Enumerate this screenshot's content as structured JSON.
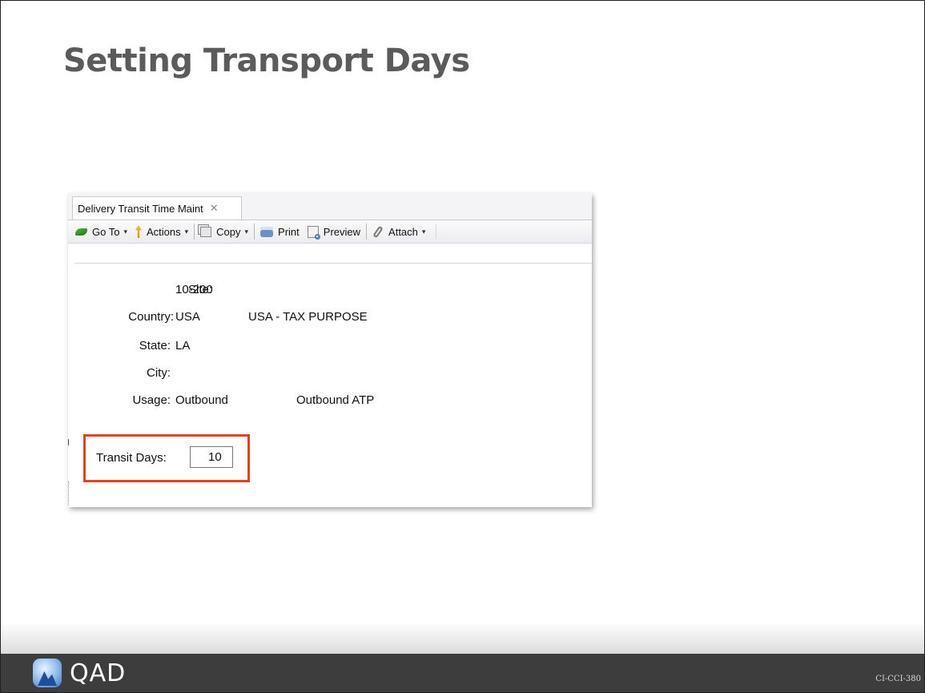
{
  "slide": {
    "title": "Setting Transport Days",
    "code": "CI-CCI-380",
    "logo_text": "QAD"
  },
  "window": {
    "tab_label": "Delivery Transit Time Maint",
    "tab_close": "✕",
    "toolbar": {
      "goto_label": "Go To",
      "actions_label": "Actions",
      "copy_label": "Copy",
      "print_label": "Print",
      "preview_label": "Preview",
      "attach_label": "Attach",
      "caret": "▾"
    },
    "form": {
      "site_label": "Site:",
      "site_value": "10-200",
      "country_label": "Country:",
      "country_value": "USA",
      "country_desc": "USA - TAX PURPOSE",
      "state_label": "State:",
      "state_value": "LA",
      "city_label": "City:",
      "city_value": "",
      "usage_label": "Usage:",
      "usage_value": "Outbound",
      "usage_desc": "Outbound ATP",
      "transit_label": "Transit Days:",
      "transit_value": "10"
    },
    "colors": {
      "highlight_border": "#e0441f",
      "footer_bg": "#3d3d3d",
      "title_color": "#5b5b5b"
    },
    "icons": [
      "goto-icon",
      "actions-icon",
      "copy-icon",
      "print-icon",
      "preview-icon",
      "attach-icon",
      "close-icon"
    ]
  }
}
